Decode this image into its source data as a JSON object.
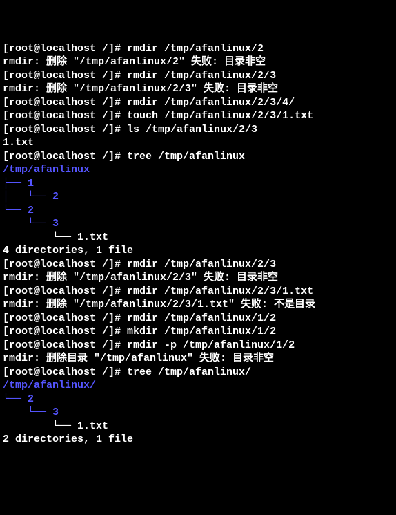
{
  "lines": [
    {
      "text": "[root@localhost /]# rmdir /tmp/afanlinux/2",
      "cls": ""
    },
    {
      "text": "rmdir: 删除 \"/tmp/afanlinux/2\" 失败: 目录非空",
      "cls": ""
    },
    {
      "text": "[root@localhost /]# rmdir /tmp/afanlinux/2/3",
      "cls": ""
    },
    {
      "text": "rmdir: 删除 \"/tmp/afanlinux/2/3\" 失败: 目录非空",
      "cls": ""
    },
    {
      "text": "[root@localhost /]# rmdir /tmp/afanlinux/2/3/4/",
      "cls": ""
    },
    {
      "text": "[root@localhost /]# touch /tmp/afanlinux/2/3/1.txt",
      "cls": ""
    },
    {
      "text": "[root@localhost /]# ls /tmp/afanlinux/2/3",
      "cls": ""
    },
    {
      "text": "1.txt",
      "cls": ""
    },
    {
      "text": "[root@localhost /]# tree /tmp/afanlinux",
      "cls": ""
    },
    {
      "text": "/tmp/afanlinux",
      "cls": "blue"
    },
    {
      "text": "├── 1",
      "cls": "blue"
    },
    {
      "text": "│   └── 2",
      "cls": "blue"
    },
    {
      "text": "└── 2",
      "cls": "blue"
    },
    {
      "text": "    └── 3",
      "cls": "blue"
    },
    {
      "text": "        └── 1.txt",
      "cls": ""
    },
    {
      "text": "",
      "cls": ""
    },
    {
      "text": "4 directories, 1 file",
      "cls": ""
    },
    {
      "text": "[root@localhost /]# rmdir /tmp/afanlinux/2/3",
      "cls": ""
    },
    {
      "text": "rmdir: 删除 \"/tmp/afanlinux/2/3\" 失败: 目录非空",
      "cls": ""
    },
    {
      "text": "[root@localhost /]# rmdir /tmp/afanlinux/2/3/1.txt",
      "cls": ""
    },
    {
      "text": "rmdir: 删除 \"/tmp/afanlinux/2/3/1.txt\" 失败: 不是目录",
      "cls": ""
    },
    {
      "text": "[root@localhost /]# rmdir /tmp/afanlinux/1/2",
      "cls": ""
    },
    {
      "text": "[root@localhost /]# mkdir /tmp/afanlinux/1/2",
      "cls": ""
    },
    {
      "text": "[root@localhost /]# rmdir -p /tmp/afanlinux/1/2",
      "cls": ""
    },
    {
      "text": "rmdir: 删除目录 \"/tmp/afanlinux\" 失败: 目录非空",
      "cls": ""
    },
    {
      "text": "[root@localhost /]# tree /tmp/afanlinux/",
      "cls": ""
    },
    {
      "text": "/tmp/afanlinux/",
      "cls": "blue"
    },
    {
      "text": "└── 2",
      "cls": "blue"
    },
    {
      "text": "    └── 3",
      "cls": "blue"
    },
    {
      "text": "        └── 1.txt",
      "cls": ""
    },
    {
      "text": "",
      "cls": ""
    },
    {
      "text": "2 directories, 1 file",
      "cls": ""
    }
  ]
}
